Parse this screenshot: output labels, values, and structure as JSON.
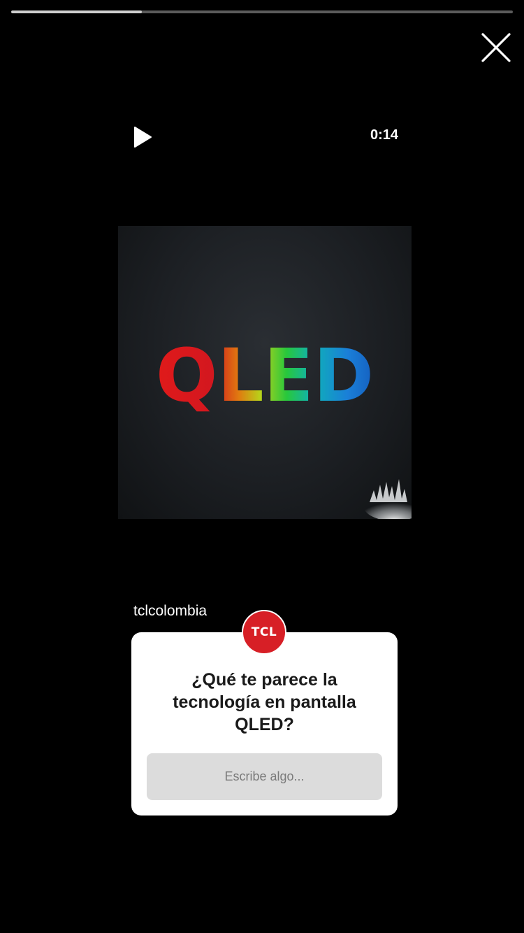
{
  "story": {
    "progress_fraction": 0.26,
    "username": "tclcolombia",
    "avatar_text": "TCL",
    "close_icon": "close-icon"
  },
  "video": {
    "play_icon": "play-icon",
    "time": "0:14",
    "title_text": "QLED"
  },
  "question_sticker": {
    "question": "¿Qué te parece la\ntecnología en pantalla\nQLED?",
    "input_placeholder": "Escribe algo..."
  },
  "colors": {
    "background": "#000000",
    "avatar_red": "#d71f26",
    "card": "#ffffff",
    "input_bg": "#dcdcdc"
  }
}
